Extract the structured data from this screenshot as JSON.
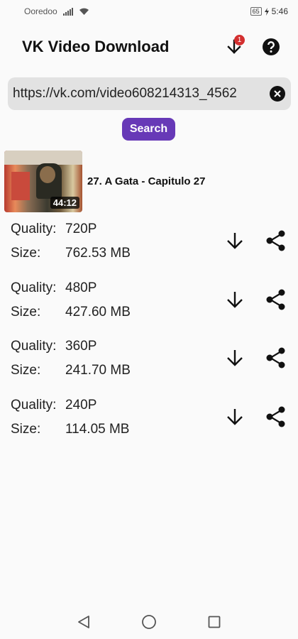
{
  "status_bar": {
    "carrier": "Ooredoo",
    "battery": "65",
    "time": "5:46"
  },
  "header": {
    "title": "VK Video Download",
    "download_badge": "1"
  },
  "url_field": {
    "value": "https://vk.com/video608214313_4562"
  },
  "search_button": {
    "label": "Search"
  },
  "video": {
    "title": "27. A Gata - Capitulo 27",
    "duration": "44:12"
  },
  "qualities": [
    {
      "quality_label": "Quality:",
      "quality": "720P",
      "size_label": "Size:",
      "size": "762.53 MB"
    },
    {
      "quality_label": "Quality:",
      "quality": "480P",
      "size_label": "Size:",
      "size": "427.60 MB"
    },
    {
      "quality_label": "Quality:",
      "quality": "360P",
      "size_label": "Size:",
      "size": "241.70 MB"
    },
    {
      "quality_label": "Quality:",
      "quality": "240P",
      "size_label": "Size:",
      "size": "114.05 MB"
    }
  ],
  "colors": {
    "accent": "#6739b7",
    "badge": "#d32f2f",
    "field_bg": "#e2e2e2"
  },
  "icons": {
    "header_download": "download-arrow-icon",
    "header_help": "help-circle-icon",
    "clear": "clear-icon",
    "row_download": "download-arrow-icon",
    "row_share": "share-icon",
    "nav_back": "back-triangle-icon",
    "nav_home": "home-circle-icon",
    "nav_recents": "recents-square-icon"
  }
}
